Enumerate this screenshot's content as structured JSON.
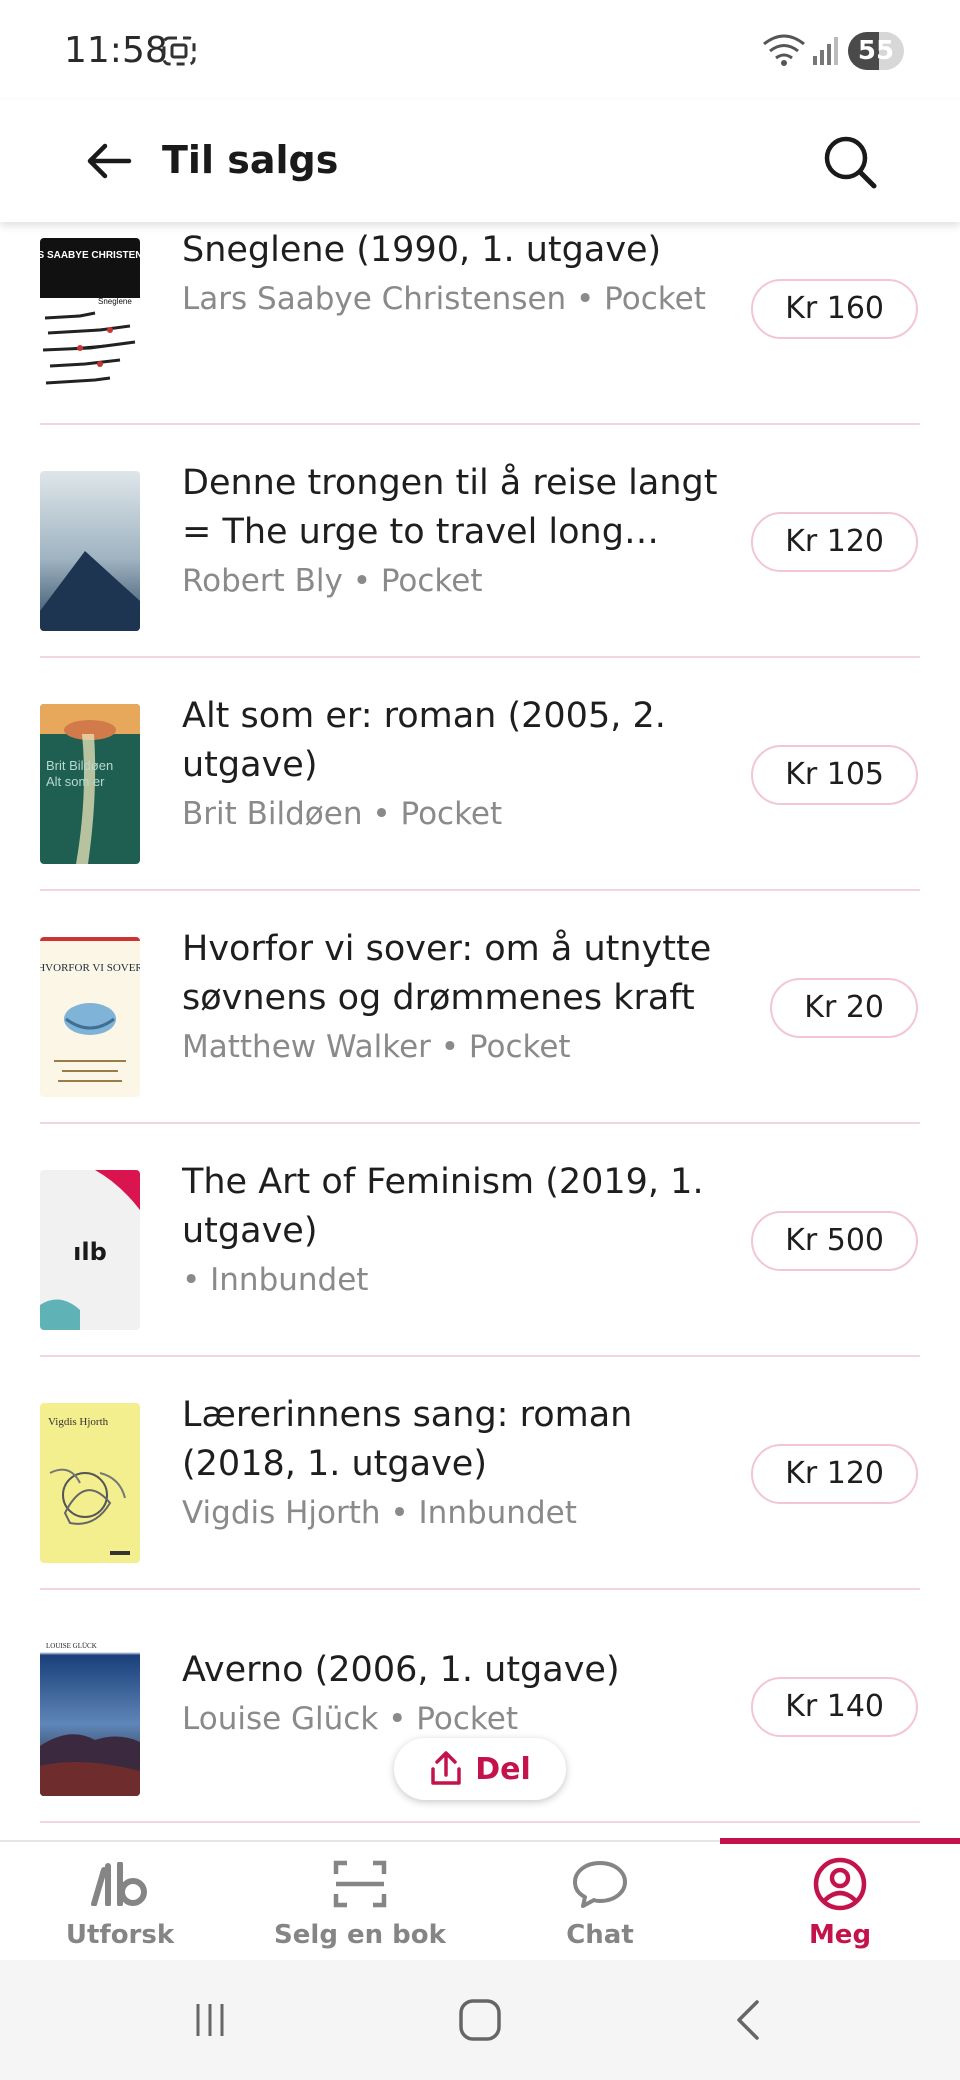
{
  "status_bar": {
    "time": "11:58",
    "battery": "55",
    "battery_fraction": 0.55
  },
  "header": {
    "title": "Til salgs"
  },
  "listings": [
    {
      "title": "Sneglene (1990, 1. utgave)",
      "meta": "Lars Saabye Christensen • Pocket",
      "price": "Kr 160",
      "cover_title": "LARS SAABYE CHRISTENSEN",
      "cover_subtitle": "Sneglene"
    },
    {
      "title": "Denne trongen til å reise langt = The urge to travel long distances",
      "meta": "Robert Bly • Pocket",
      "price": "Kr 120"
    },
    {
      "title": "Alt som er: roman (2005, 2. utgave)",
      "meta": "Brit Bildøen • Pocket",
      "price": "Kr 105",
      "cover_title": "Brit Bildøen",
      "cover_subtitle": "Alt som er"
    },
    {
      "title": "Hvorfor vi sover: om å utnytte søvnens og drømmenes kraft",
      "meta": "Matthew Walker • Pocket",
      "price": "Kr 20",
      "cover_title": "HVORFOR VI SOVER"
    },
    {
      "title": "The Art of Feminism (2019, 1. utgave)",
      "meta": " • Innbundet",
      "price": "Kr 500",
      "cover_logo": "ılb"
    },
    {
      "title": "Lærerinnens sang: roman (2018, 1. utgave)",
      "meta": "Vigdis Hjorth • Innbundet",
      "price": "Kr 120",
      "cover_title": "Vigdis Hjorth"
    },
    {
      "title": "Averno (2006, 1. utgave)",
      "meta": "Louise Glück • Pocket",
      "price": "Kr 140",
      "cover_title": "LOUISE GLÜCK"
    }
  ],
  "share": {
    "label": "Del",
    "icon": "share-icon"
  },
  "bottom_nav": {
    "items": [
      {
        "label": "Utforsk",
        "icon": "explore-logo-icon",
        "active": false
      },
      {
        "label": "Selg en bok",
        "icon": "scan-icon",
        "active": false
      },
      {
        "label": "Chat",
        "icon": "chat-bubble-icon",
        "active": false
      },
      {
        "label": "Meg",
        "icon": "profile-icon",
        "active": true
      }
    ]
  },
  "colors": {
    "accent": "#c4134b",
    "divider": "#f3d6dd",
    "price_border": "#f2c6d2",
    "muted_text": "#8a8a8a"
  }
}
